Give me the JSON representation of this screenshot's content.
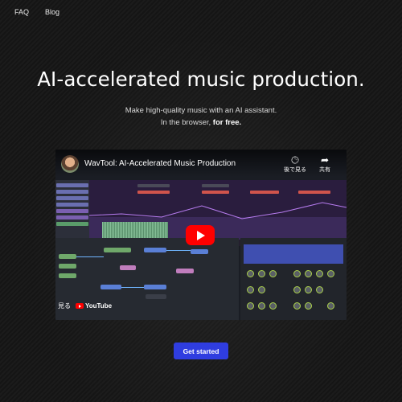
{
  "nav": {
    "faq": "FAQ",
    "blog": "Blog"
  },
  "hero": {
    "headline": "AI-accelerated music production.",
    "sub_line1": "Make high-quality music with an AI assistant.",
    "sub_line2_prefix": "In the browser,",
    "sub_line2_bold": "for free."
  },
  "video": {
    "title": "WavTool: AI-Accelerated Music Production",
    "watch_later_label": "後で見る",
    "share_label": "共有",
    "watch_on_label": "見る",
    "youtube_label": "YouTube",
    "icons": [
      "clock-icon",
      "share-icon",
      "play-icon",
      "youtube-logo"
    ]
  },
  "cta": {
    "label": "Get started"
  },
  "colors": {
    "background": "#171717",
    "accent": "#2f3de0",
    "youtube_red": "#ff0000"
  }
}
